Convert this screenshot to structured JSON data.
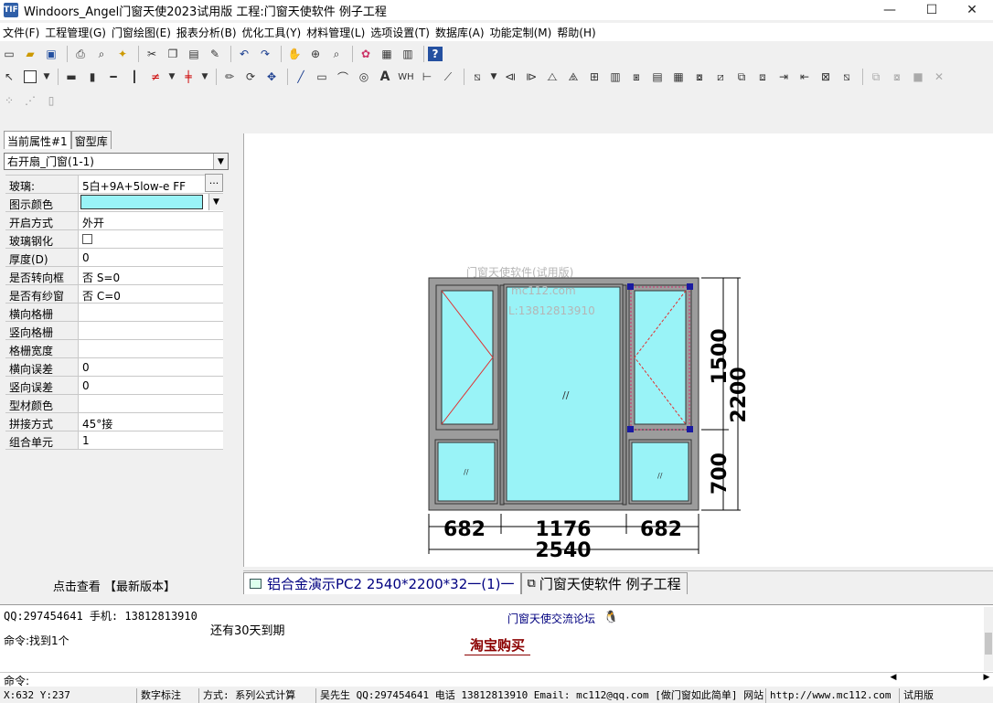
{
  "window": {
    "title": "Windoors_Angel门窗天使2023试用版  工程:门窗天使软件 例子工程",
    "minimize": "—",
    "maximize": "☐",
    "close": "✕"
  },
  "menu": [
    "文件(F)",
    "工程管理(G)",
    "门窗绘图(E)",
    "报表分析(B)",
    "优化工具(Y)",
    "材料管理(L)",
    "选项设置(T)",
    "数据库(A)",
    "功能定制(M)",
    "帮助(H)"
  ],
  "left_panel": {
    "tabs": [
      "当前属性#1",
      "窗型库"
    ],
    "component_select": "右开扇_门窗(1-1)",
    "ellipsis": "···",
    "properties": [
      {
        "key": "玻璃:",
        "value": "5白+9A+5low-e FF"
      },
      {
        "key": "图示颜色",
        "value": ""
      },
      {
        "key": "开启方式",
        "value": "外开"
      },
      {
        "key": "玻璃钢化",
        "value": ""
      },
      {
        "key": "厚度(D)",
        "value": "0"
      },
      {
        "key": "是否转向框",
        "value": "否 S=0"
      },
      {
        "key": "是否有纱窗",
        "value": "否 C=0"
      },
      {
        "key": "横向格栅",
        "value": ""
      },
      {
        "key": "竖向格栅",
        "value": ""
      },
      {
        "key": "格栅宽度",
        "value": ""
      },
      {
        "key": "横向误差",
        "value": "0"
      },
      {
        "key": "竖向误差",
        "value": "0"
      },
      {
        "key": "型材颜色",
        "value": ""
      },
      {
        "key": "拼接方式",
        "value": "45°接"
      },
      {
        "key": "组合单元",
        "value": "1"
      }
    ],
    "glass_color": "#99f3f7",
    "footer": "点击查看 【最新版本】"
  },
  "drawing": {
    "watermark": [
      "门窗天使软件(试用版)",
      "mc112.com",
      "L:13812813910"
    ],
    "glass_color": "#99f3f7",
    "frame_color": "#9c9c9c",
    "dimensions": {
      "right_upper": "1500",
      "right_total": "2200",
      "right_lower": "700",
      "bottom_left": "682",
      "bottom_middle": "1176",
      "bottom_right": "682",
      "bottom_total": "2540"
    }
  },
  "doc_tabs": [
    "铝合金演示PC2 2540*2200*32一(1)一",
    "门窗天使软件 例子工程"
  ],
  "output": {
    "line1": "QQ:297454641 手机: 13812813910",
    "line2": "命令:找到1个",
    "expiry": "还有30天到期",
    "forum_link": "门窗天使交流论坛",
    "buy_link": "淘宝购买"
  },
  "command_line": "命令:",
  "status": {
    "coords": "X:632  Y:237",
    "mode": "数字标注",
    "method": "方式: 系列公式计算",
    "contact": "吴先生 QQ:297454641 电话 13812813910 Email: mc112@qq.com [做门窗如此简单]  网站",
    "site": "http://www.mc112.com",
    "edition": "试用版"
  }
}
